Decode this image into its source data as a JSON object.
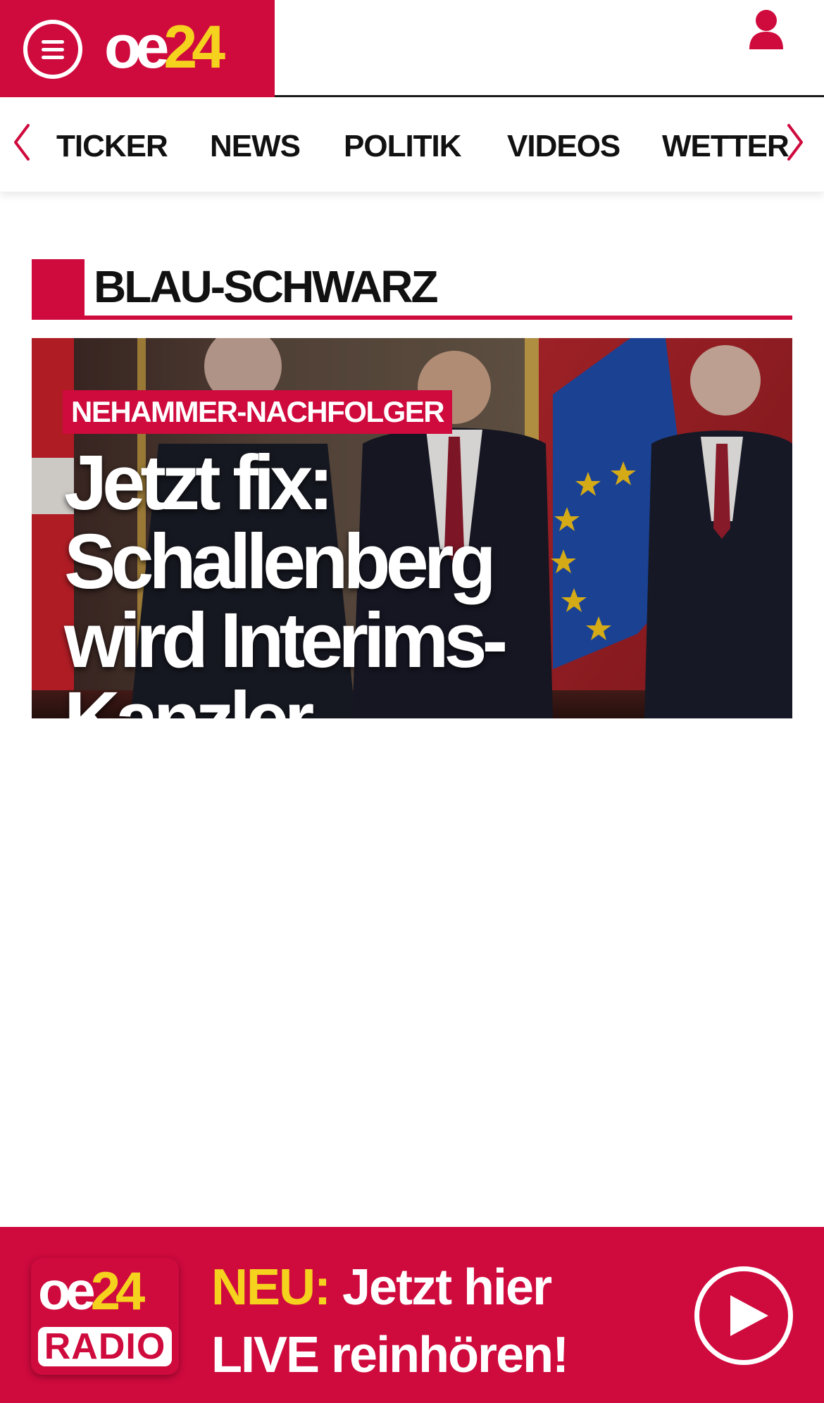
{
  "header": {
    "logo_oe": "oe",
    "logo_num": "24",
    "menu_icon": "hamburger-menu-icon",
    "user_icon": "user-icon",
    "brand_color": "#cf0a3d",
    "accent_color": "#f5d21e"
  },
  "nav": {
    "items": [
      {
        "label": "TICKER"
      },
      {
        "label": "NEWS"
      },
      {
        "label": "POLITIK"
      },
      {
        "label": "VIDEOS"
      },
      {
        "label": "WETTER"
      }
    ],
    "prev_icon": "chevron-left-icon",
    "next_icon": "chevron-right-icon"
  },
  "section": {
    "title": "BLAU-SCHWARZ"
  },
  "article": {
    "kicker": "NEHAMMER-NACHFOLGER",
    "headline_line1": "Jetzt fix:",
    "headline_line2": "Schallenberg",
    "headline_line3": "wird Interims-Kanzler"
  },
  "banner": {
    "logo_oe": "oe",
    "logo_num": "24",
    "logo_radio": "RADIO",
    "neu": "NEU:",
    "text_line1": "Jetzt hier",
    "text_line2": "LIVE reinhören!",
    "play_icon": "play-icon"
  }
}
